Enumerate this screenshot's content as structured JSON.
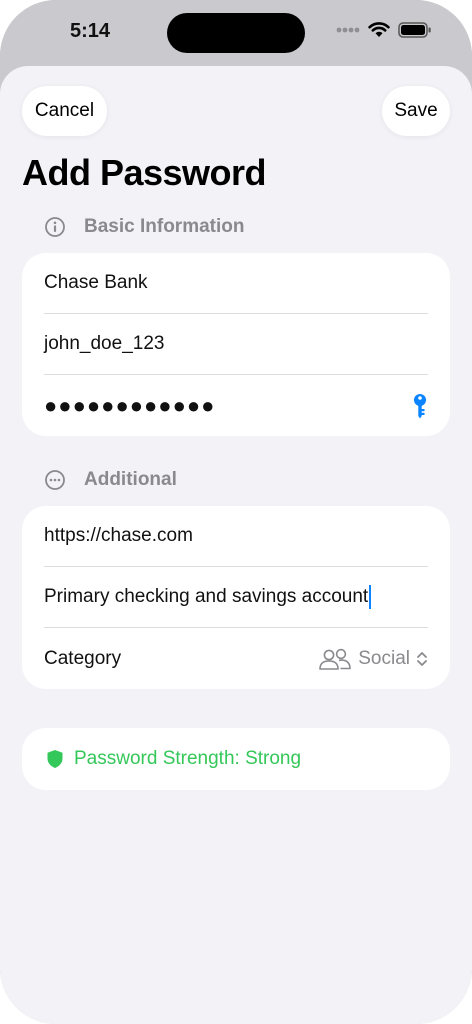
{
  "status_bar": {
    "time": "5:14"
  },
  "nav": {
    "cancel_label": "Cancel",
    "save_label": "Save"
  },
  "page_title": "Add Password",
  "basic_section": {
    "header": "Basic Information",
    "icon": "info-circle-icon",
    "title_value": "Chase Bank",
    "username_value": "john_doe_123",
    "password_value": "●●●●●●●●●●●●"
  },
  "additional_section": {
    "header": "Additional",
    "icon": "ellipsis-circle-icon",
    "url_value": "https://chase.com",
    "notes_value": "Primary checking and savings account",
    "category_label": "Category",
    "category_value": "Social",
    "category_icon": "person-2-icon"
  },
  "strength": {
    "label": "Password Strength: Strong",
    "color": "#34c759",
    "icon": "shield-icon"
  },
  "colors": {
    "accent": "#0a84ff",
    "background": "#f2f2f7",
    "secondary_text": "#8a8a8e"
  }
}
